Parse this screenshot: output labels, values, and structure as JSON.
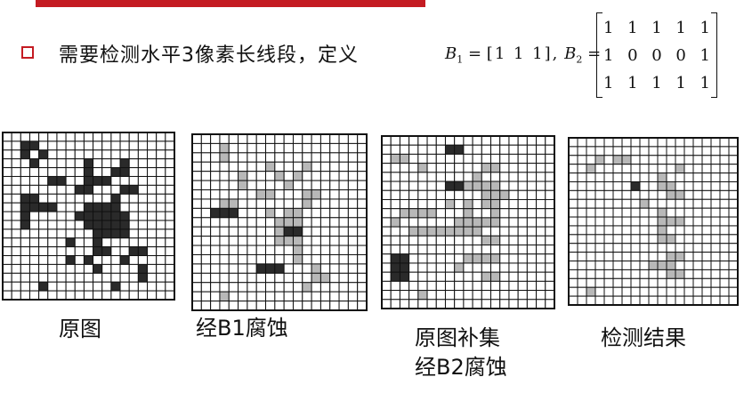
{
  "header": {
    "headline": "需要检测水平3像素长线段，定义",
    "b1_symbol": "B",
    "b1_sub": "1",
    "b1_vector": "[1  1  1],",
    "b2_symbol": "B",
    "b2_sub": "2",
    "equals": "=",
    "b2_matrix": [
      [
        "1",
        "1",
        "1",
        "1",
        "1"
      ],
      [
        "1",
        "0",
        "0",
        "0",
        "1"
      ],
      [
        "1",
        "1",
        "1",
        "1",
        "1"
      ]
    ]
  },
  "colors": {
    "accent": "#c41b22",
    "black_cell": "#2a2a2a",
    "gray_cell": "#b8b8b8"
  },
  "panels": [
    {
      "caption": "原图",
      "grid": [
        "0000000000000000000",
        "0011000000000000000",
        "0010100000000000000",
        "0001000001000100000",
        "0000000001001100000",
        "0000011001110000000",
        "0000000011000110000",
        "0011000000001000000",
        "0011110001111000000",
        "0010000011111100000",
        "0010000001111100000",
        "0000000000111100000",
        "0000000100100000000",
        "0000000000110011000",
        "0000000101000100000",
        "0000000000100001000",
        "0000000000000001000",
        "0000100000001000000",
        "0000000000000000000"
      ]
    },
    {
      "caption": "经B1腐蚀",
      "grid": [
        "0000000000000000000",
        "0002000000000000000",
        "0002000000000000000",
        "0000000020002000000",
        "0000020002020000000",
        "0000020000200000000",
        "0000000220002200000",
        "0002200000002000000",
        "0011100020220000000",
        "0000000002220000000",
        "0000000002110000000",
        "0000000002220000000",
        "0000000000020000000",
        "0000000000020000000",
        "0000000111000200000",
        "0000000000000220000",
        "0000000000002000000",
        "0002000000000000000",
        "0000000000000000000"
      ]
    },
    {
      "caption_lines": [
        "原图补集",
        "经B2腐蚀"
      ],
      "grid": [
        "0000000000000000000",
        "0000000110000000000",
        "0220000000000000000",
        "0000200000022000000",
        "0000000000200000000",
        "0000000112222000000",
        "0000000000022200000",
        "0000000202022000000",
        "0022220002002000000",
        "0200000022222000000",
        "0002222222200000000",
        "0000000000022000000",
        "0000000000000000000",
        "0110000002222000000",
        "0110000020000000000",
        "0110000000022000000",
        "0000000000000000000",
        "0000200000000000000",
        "0000000000000000000"
      ]
    },
    {
      "caption": "检测结果",
      "grid": [
        "0000000000000000000",
        "0000000000000000000",
        "0002022000000000000",
        "0020000000002000000",
        "0000000000200000000",
        "0000000100220000000",
        "0000000000022000000",
        "0000000020000000000",
        "0000000000200000000",
        "0000000000222000000",
        "0000000000200000000",
        "0000000000220000000",
        "0000000000000000000",
        "0000000000022000000",
        "0000000002220000000",
        "0000000000022000000",
        "0000000000000000000",
        "0020000000000000000",
        "0000000000000000000"
      ]
    }
  ]
}
